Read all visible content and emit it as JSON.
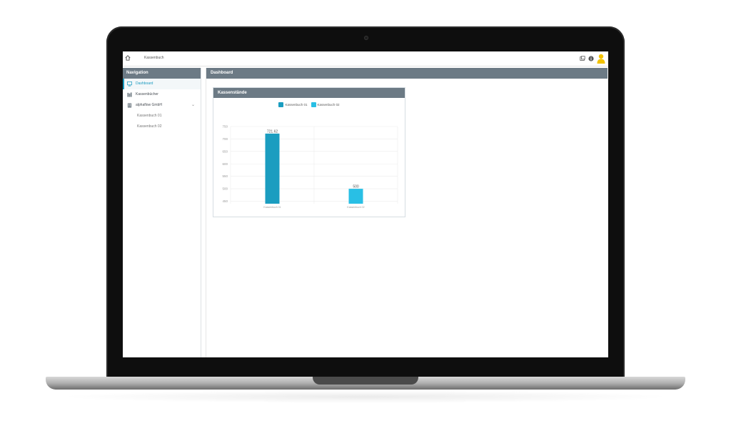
{
  "app": {
    "breadcrumb": "Kassenbuch",
    "colors": {
      "header": "#6c7a85",
      "accent": "#1a9ac0",
      "series1": "#1b9dc0",
      "series2": "#29bfe5"
    }
  },
  "topbar": {
    "icons": [
      "home-icon",
      "window-icon",
      "info-icon",
      "user-icon"
    ]
  },
  "navigation": {
    "title": "Navigation",
    "items": [
      {
        "label": "Dashboard",
        "icon": "dashboard-icon",
        "active": true
      },
      {
        "label": "Kassenbücher",
        "icon": "books-icon",
        "active": false
      },
      {
        "label": "alphaflow GmbH",
        "icon": "building-icon",
        "active": false,
        "expanded": true
      }
    ],
    "subitems": [
      {
        "label": "Kassenbuch 01"
      },
      {
        "label": "Kassenbuch 02"
      }
    ]
  },
  "main": {
    "title": "Dashboard",
    "card": {
      "title": "Kassenstände"
    }
  },
  "chart_data": {
    "type": "bar",
    "categories": [
      "Kassenbuch 01",
      "Kassenbuch 02"
    ],
    "series": [
      {
        "name": "Kassenbuch 01",
        "values": [
          721.62,
          null
        ],
        "color": "#1b9dc0"
      },
      {
        "name": "Kassenbuch 02",
        "values": [
          null,
          500
        ],
        "color": "#29bfe5"
      }
    ],
    "data_labels": [
      "721.62",
      "500"
    ],
    "yticks": [
      750,
      700,
      650,
      600,
      550,
      500,
      450
    ],
    "ylim": [
      440,
      750
    ],
    "legend": "top-center",
    "grid": true
  }
}
